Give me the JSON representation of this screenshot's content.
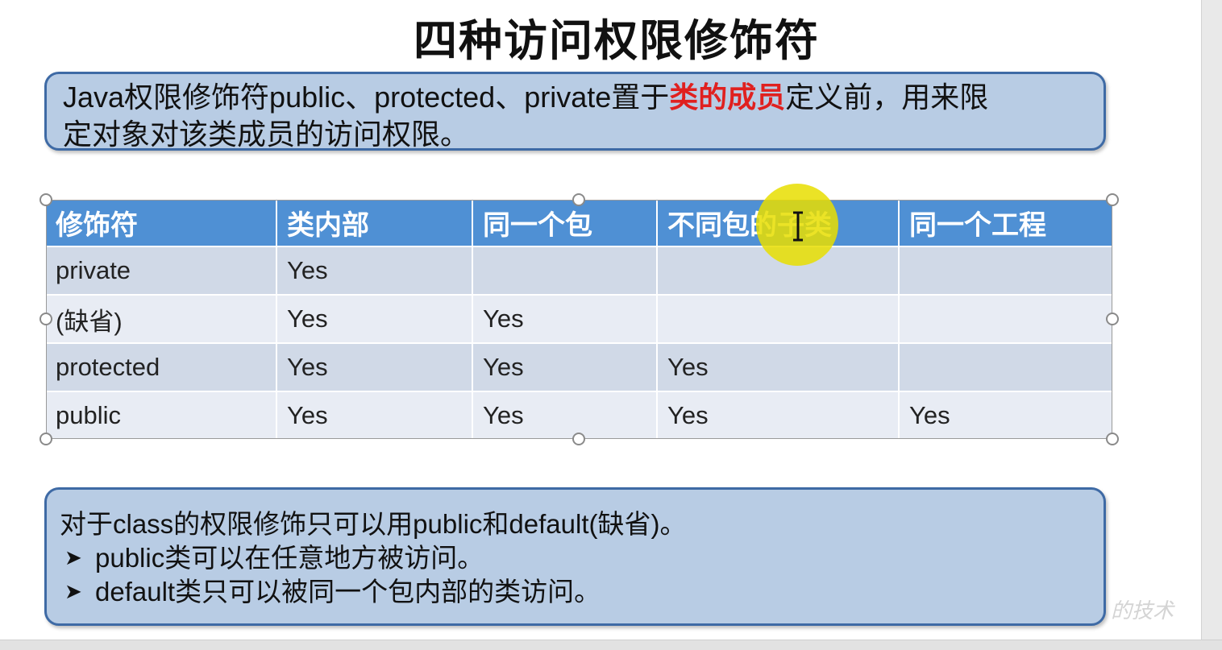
{
  "slide": {
    "title": "四种访问权限修饰符",
    "intro": {
      "part1": "Java权限修饰符public、protected、private置于",
      "highlight": "类的成员",
      "part2": "定义前，用来限",
      "line2": "定对象对该类成员的访问权限。",
      "highlight_color": "#e0201f"
    },
    "table": {
      "headers": [
        "修饰符",
        "类内部",
        "同一个包",
        "不同包的子类",
        "同一个工程"
      ],
      "rows": [
        [
          "private",
          "Yes",
          "",
          "",
          ""
        ],
        [
          "(缺省)",
          "Yes",
          "Yes",
          "",
          ""
        ],
        [
          "protected",
          "Yes",
          "Yes",
          "Yes",
          ""
        ],
        [
          "public",
          "Yes",
          "Yes",
          "Yes",
          "Yes"
        ]
      ],
      "header_color": "#4f90d4"
    },
    "class_note": {
      "line1": "对于class的权限修饰只可以用public和default(缺省)。",
      "bullets": [
        "public类可以在任意地方被访问。",
        "default类只可以被同一个包内部的类访问。"
      ]
    },
    "watermark": "的技术"
  },
  "icons": {
    "bullet": "right-arrowhead-icon",
    "cursor": "text-cursor-icon",
    "handle": "resize-handle-icon"
  }
}
